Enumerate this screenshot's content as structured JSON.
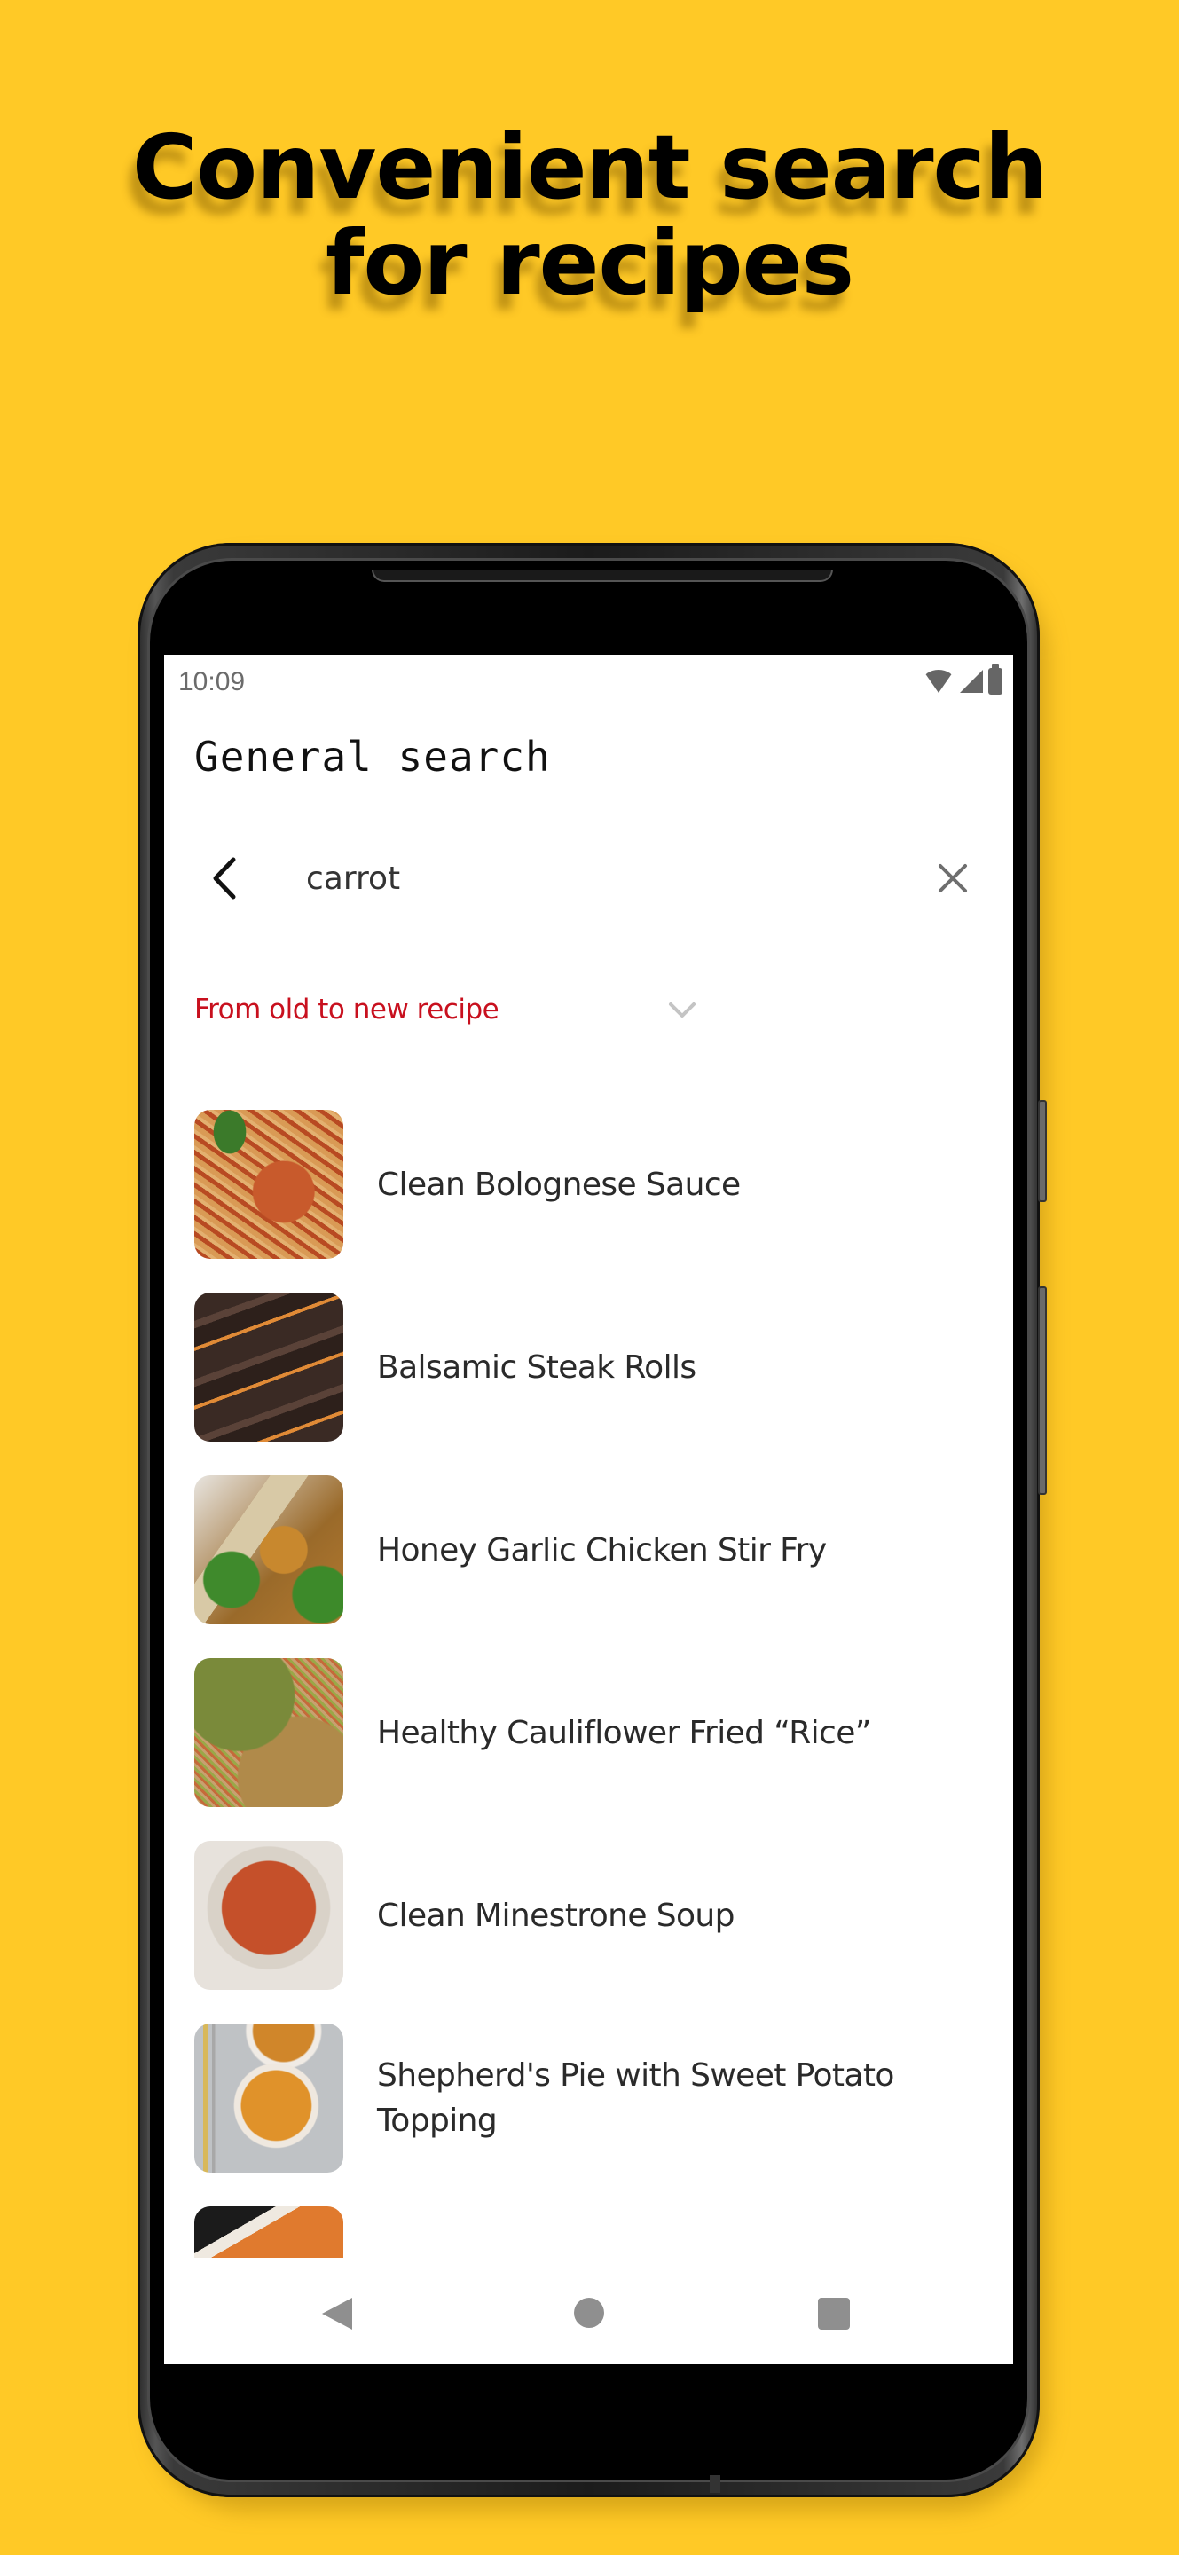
{
  "headline": {
    "line1": "Convenient search",
    "line2": "for recipes"
  },
  "colors": {
    "background": "#FFC926",
    "sort_accent": "#C8101E",
    "text_primary": "#2a2a2a",
    "icon_gray": "#8f8f8f"
  },
  "status_bar": {
    "time": "10:09",
    "icons": [
      "wifi-icon",
      "signal-icon",
      "battery-icon"
    ]
  },
  "header": {
    "title": "General search"
  },
  "search": {
    "back_icon": "chevron-left-icon",
    "value": "carrot",
    "placeholder": "",
    "clear_icon": "close-icon"
  },
  "sort": {
    "selected": "From old to new recipe",
    "icon": "chevron-down-icon"
  },
  "recipes": [
    {
      "title": "Clean Bolognese Sauce",
      "image": "bolognese-photo"
    },
    {
      "title": "Balsamic Steak Rolls",
      "image": "steak-rolls-photo"
    },
    {
      "title": "Honey Garlic Chicken Stir Fry",
      "image": "chicken-stir-fry-photo"
    },
    {
      "title": "Healthy Cauliflower Fried “Rice”",
      "image": "cauliflower-rice-photo"
    },
    {
      "title": "Clean Minestrone Soup",
      "image": "minestrone-photo"
    },
    {
      "title": "Shepherd's Pie with Sweet Potato Topping",
      "image": "shepherds-pie-photo"
    },
    {
      "title": "",
      "image": "casserole-photo"
    }
  ],
  "nav_bar": {
    "back": "nav-back-icon",
    "home": "nav-home-icon",
    "recents": "nav-recents-icon"
  }
}
